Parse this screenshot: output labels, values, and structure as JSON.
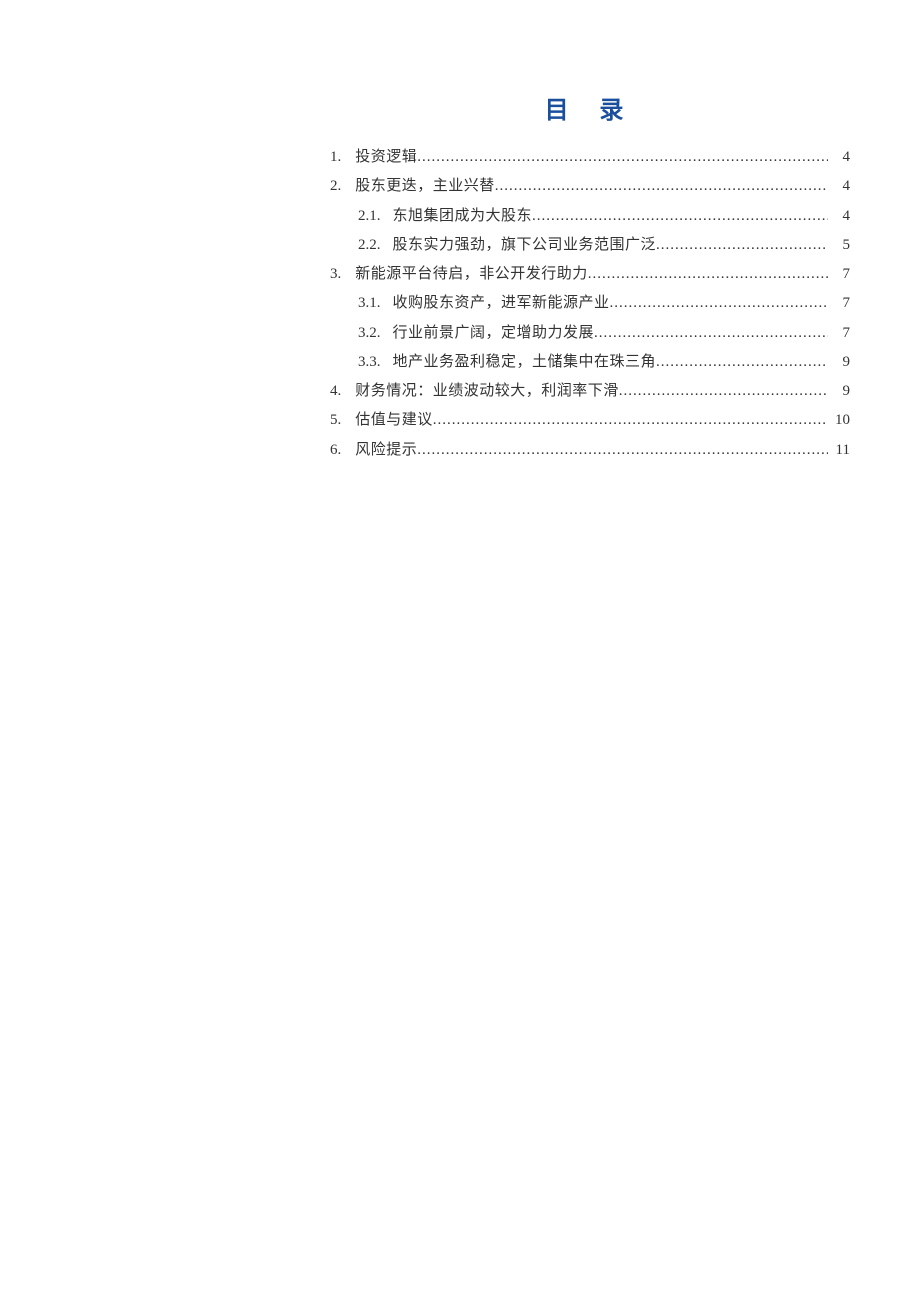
{
  "title": "目 录",
  "toc": [
    {
      "level": 1,
      "num": "1.",
      "label": "投资逻辑",
      "page": "4"
    },
    {
      "level": 1,
      "num": "2.",
      "label": "股东更迭，主业兴替",
      "page": "4"
    },
    {
      "level": 2,
      "num": "2.1.",
      "label": "东旭集团成为大股东",
      "page": "4"
    },
    {
      "level": 2,
      "num": "2.2.",
      "label": "股东实力强劲，旗下公司业务范围广泛",
      "page": "5"
    },
    {
      "level": 1,
      "num": "3.",
      "label": "新能源平台待启，非公开发行助力",
      "page": "7"
    },
    {
      "level": 2,
      "num": "3.1.",
      "label": "收购股东资产，进军新能源产业",
      "page": "7"
    },
    {
      "level": 2,
      "num": "3.2.",
      "label": "行业前景广阔，定增助力发展",
      "page": "7"
    },
    {
      "level": 2,
      "num": "3.3.",
      "label": "地产业务盈利稳定，土储集中在珠三角",
      "page": "9"
    },
    {
      "level": 1,
      "num": "4.",
      "label": "财务情况：业绩波动较大，利润率下滑",
      "page": "9"
    },
    {
      "level": 1,
      "num": "5.",
      "label": "估值与建议",
      "page": "10"
    },
    {
      "level": 1,
      "num": "6.",
      "label": "风险提示",
      "page": "11"
    }
  ]
}
